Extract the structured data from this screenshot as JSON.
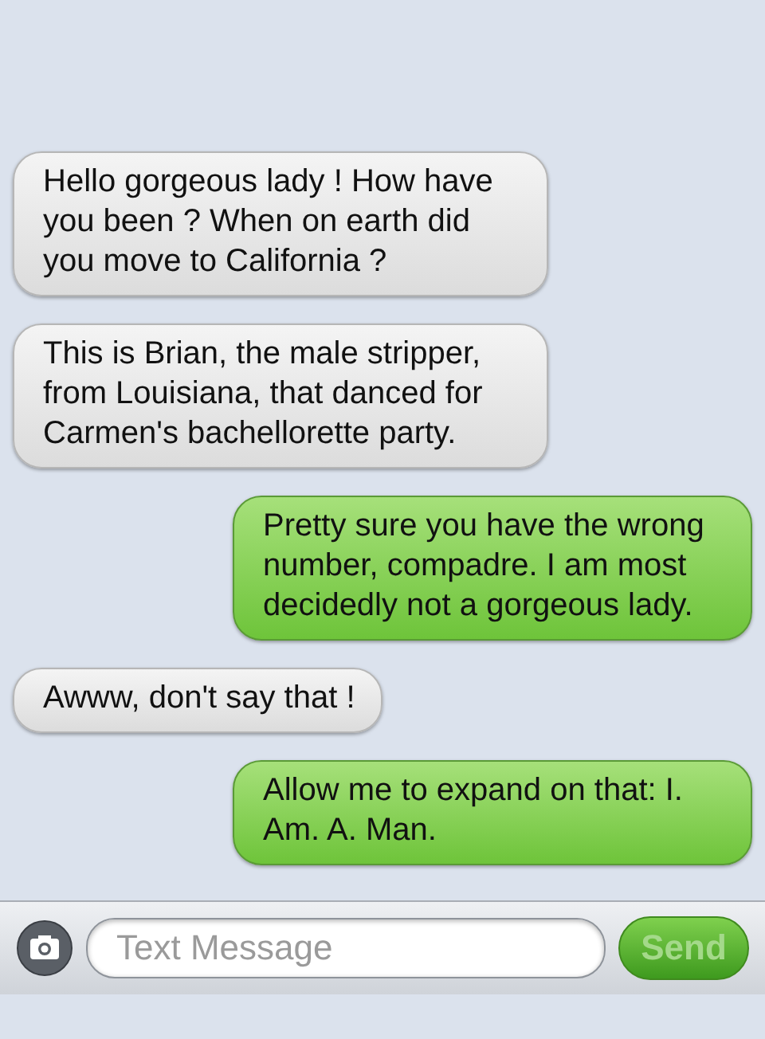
{
  "messages": [
    {
      "kind": "received",
      "text": "Hello gorgeous lady !  How have you been ?  When on earth did you move to California ?"
    },
    {
      "kind": "received",
      "text": "This is Brian, the male stripper, from Louisiana, that danced for Carmen's bachellorette party."
    },
    {
      "kind": "sent",
      "text": "Pretty sure you have the wrong number, compadre. I am most decidedly not a gorgeous lady."
    },
    {
      "kind": "received",
      "text": "Awww, don't say that !"
    },
    {
      "kind": "sent",
      "text": "Allow me to expand on that: I. Am. A. Man."
    }
  ],
  "composer": {
    "placeholder": "Text Message",
    "send": {
      "label": "Send",
      "disabled": true
    }
  }
}
